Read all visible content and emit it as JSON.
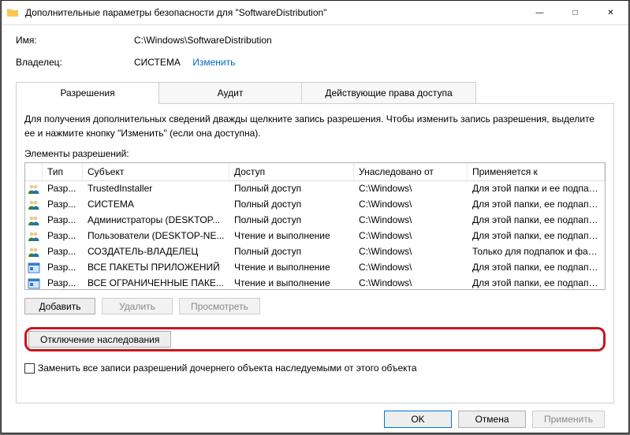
{
  "window": {
    "title": "Дополнительные параметры безопасности  для \"SoftwareDistribution\""
  },
  "fields": {
    "name_label": "Имя:",
    "name_value": "C:\\Windows\\SoftwareDistribution",
    "owner_label": "Владелец:",
    "owner_value": "СИСТЕМА",
    "owner_change": "Изменить"
  },
  "tabs": {
    "perm": "Разрешения",
    "audit": "Аудит",
    "effective": "Действующие права доступа"
  },
  "hint": "Для получения дополнительных сведений дважды щелкните запись разрешения. Чтобы изменить запись разрешения, выделите ее и нажмите кнопку \"Изменить\" (если она доступна).",
  "list_label": "Элементы разрешений:",
  "columns": {
    "type": "Тип",
    "subject": "Субъект",
    "access": "Доступ",
    "inherited": "Унаследовано от",
    "applies": "Применяется к"
  },
  "rows": [
    {
      "icon": "users",
      "type": "Разр...",
      "subject": "TrustedInstaller",
      "access": "Полный доступ",
      "inherited": "C:\\Windows\\",
      "applies": "Для этой папки и ее подпап..."
    },
    {
      "icon": "users",
      "type": "Разр...",
      "subject": "СИСТЕМА",
      "access": "Полный доступ",
      "inherited": "C:\\Windows\\",
      "applies": "Для этой папки, ее подпапо..."
    },
    {
      "icon": "users",
      "type": "Разр...",
      "subject": "Администраторы (DESKTOP...",
      "access": "Полный доступ",
      "inherited": "C:\\Windows\\",
      "applies": "Для этой папки, ее подпапо..."
    },
    {
      "icon": "users",
      "type": "Разр...",
      "subject": "Пользователи (DESKTOP-NE...",
      "access": "Чтение и выполнение",
      "inherited": "C:\\Windows\\",
      "applies": "Для этой папки, ее подпапо..."
    },
    {
      "icon": "users",
      "type": "Разр...",
      "subject": "СОЗДАТЕЛЬ-ВЛАДЕЛЕЦ",
      "access": "Полный доступ",
      "inherited": "C:\\Windows\\",
      "applies": "Только для подпапок и фай..."
    },
    {
      "icon": "pkg",
      "type": "Разр...",
      "subject": "ВСЕ ПАКЕТЫ ПРИЛОЖЕНИЙ",
      "access": "Чтение и выполнение",
      "inherited": "C:\\Windows\\",
      "applies": "Для этой папки, ее подпапо..."
    },
    {
      "icon": "pkg",
      "type": "Разр...",
      "subject": "ВСЕ ОГРАНИЧЕННЫЕ ПАКЕ...",
      "access": "Чтение и выполнение",
      "inherited": "C:\\Windows\\",
      "applies": "Для этой папки, ее подпапо..."
    }
  ],
  "buttons": {
    "add": "Добавить",
    "remove": "Удалить",
    "view": "Просмотреть",
    "disable_inherit": "Отключение наследования"
  },
  "checkbox": {
    "label": "Заменить все записи разрешений дочернего объекта наследуемыми от этого объекта"
  },
  "footer": {
    "ok": "OK",
    "cancel": "Отмена",
    "apply": "Применить"
  }
}
